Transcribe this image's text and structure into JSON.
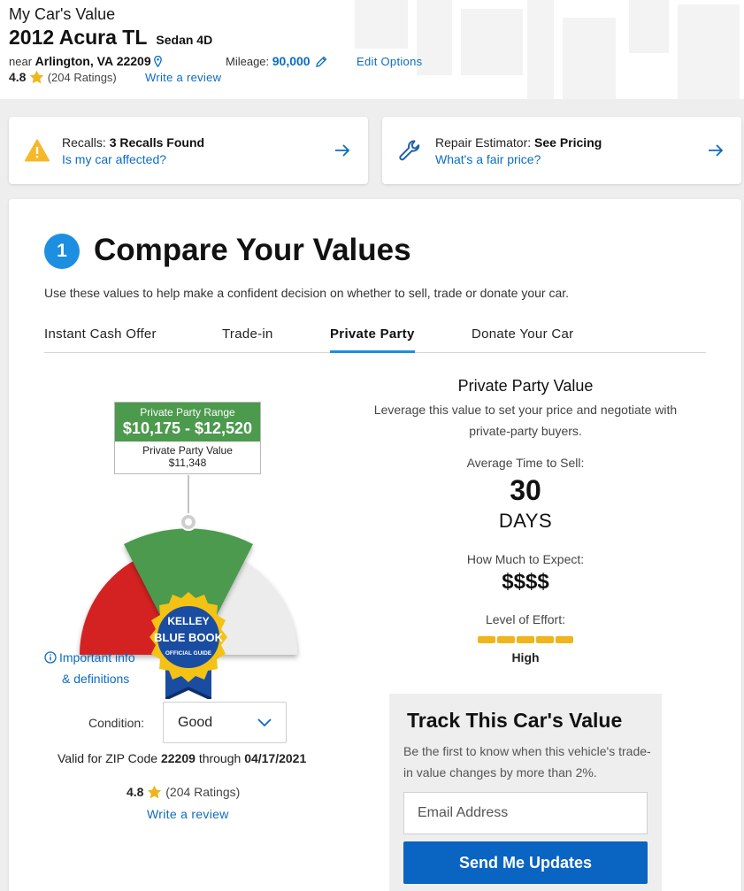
{
  "header": {
    "eyebrow": "My Car's Value",
    "title": "2012 Acura TL",
    "body_style": "Sedan 4D",
    "near_label": "near",
    "location": "Arlington, VA",
    "zip": "22209",
    "mileage_label": "Mileage:",
    "mileage": "90,000",
    "edit_options": "Edit Options",
    "rating": "4.8",
    "rating_count": "(204 Ratings)",
    "write_review": "Write a review"
  },
  "cards": {
    "recall": {
      "label": "Recalls:",
      "value": "3 Recalls Found",
      "link": "Is my car affected?"
    },
    "repair": {
      "label": "Repair Estimator:",
      "value": "See Pricing",
      "link": "What's a fair price?"
    }
  },
  "compare": {
    "step": "1",
    "title": "Compare Your Values",
    "description": "Use these values to help make a confident decision on whether to sell, trade or donate your car.",
    "tabs": [
      "Instant Cash Offer",
      "Trade-in",
      "Private Party",
      "Donate Your Car"
    ],
    "active_tab": "Private Party"
  },
  "gauge": {
    "range_label": "Private Party Range",
    "range_value": "$10,175 - $12,520",
    "value_label": "Private Party Value",
    "value": "$11,348",
    "range_low": 10175,
    "range_high": 12520,
    "point_value": 11348,
    "colors": {
      "low": "#d42121",
      "range": "#4c9a4d",
      "high": "#ececec"
    },
    "logo_lines": [
      "KELLEY",
      "BLUE BOOK",
      "OFFICIAL GUIDE"
    ]
  },
  "info": {
    "important_line1": "Important info",
    "important_line2": "& definitions"
  },
  "condition": {
    "label": "Condition:",
    "selected": "Good"
  },
  "valid": {
    "prefix": "Valid for ZIP Code",
    "zip": "22209",
    "through": "through",
    "date": "04/17/2021"
  },
  "bottom_rating": {
    "rating": "4.8",
    "count": "(204 Ratings)",
    "write_review": "Write a review"
  },
  "value_panel": {
    "title": "Private Party Value",
    "description": "Leverage this value to set your price and negotiate with private-party buyers.",
    "avg_time_label": "Average Time to Sell:",
    "avg_time_value": "30",
    "avg_time_unit": "DAYS",
    "expect_label": "How Much to Expect:",
    "expect_value": "$$$$",
    "effort_label": "Level of Effort:",
    "effort_level": 5,
    "effort_max": 5,
    "effort_text": "High"
  },
  "track": {
    "title": "Track This Car's Value",
    "description": "Be the first to know when this vehicle's trade-in value changes by more than 2%.",
    "email_placeholder": "Email Address",
    "button": "Send Me Updates"
  }
}
